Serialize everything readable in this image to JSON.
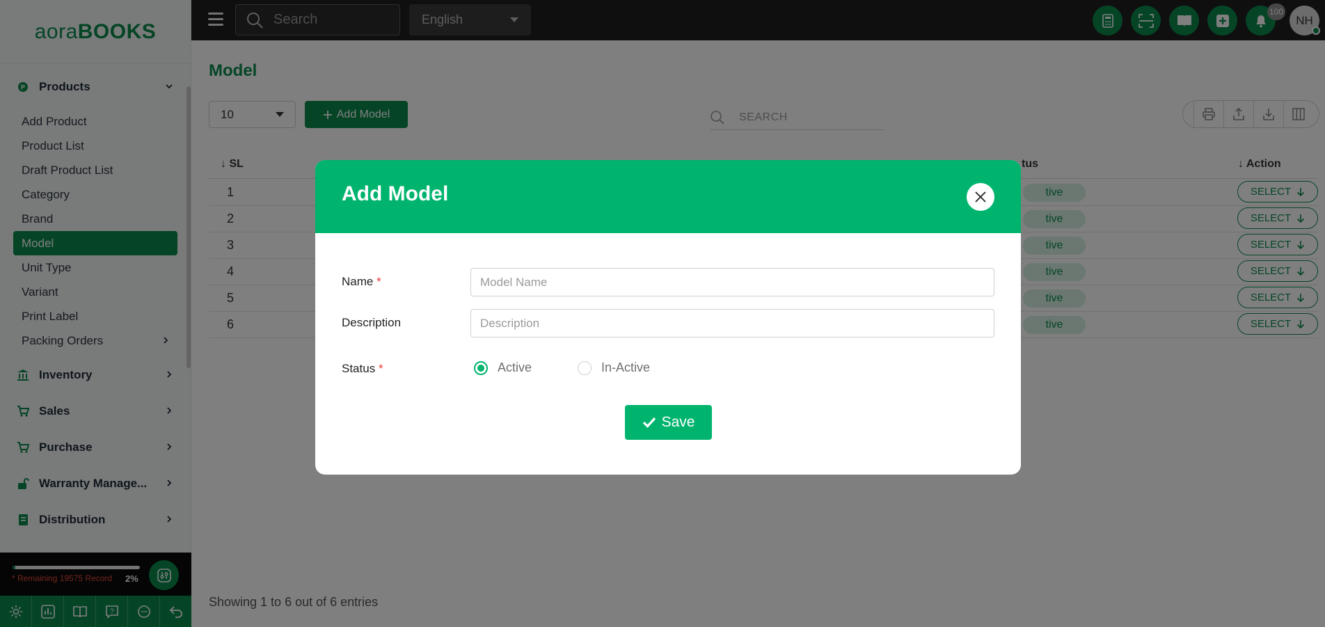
{
  "brand": {
    "logo_light": "aora",
    "logo_bold": "BOOKS"
  },
  "sidebar": {
    "groups": [
      {
        "label": "Products",
        "icon": "products-icon"
      },
      {
        "label": "Inventory",
        "icon": "bank-icon"
      },
      {
        "label": "Sales",
        "icon": "cart-icon"
      },
      {
        "label": "Purchase",
        "icon": "cart-icon"
      },
      {
        "label": "Warranty Manage...",
        "icon": "lock-icon"
      },
      {
        "label": "Distribution",
        "icon": "book-icon"
      }
    ],
    "items": [
      {
        "label": "Add Product"
      },
      {
        "label": "Product List"
      },
      {
        "label": "Draft Product List"
      },
      {
        "label": "Category"
      },
      {
        "label": "Brand"
      },
      {
        "label": "Model"
      },
      {
        "label": "Unit Type"
      },
      {
        "label": "Variant"
      },
      {
        "label": "Print Label"
      },
      {
        "label": "Packing Orders"
      }
    ],
    "remaining_text": "* Remaining 19575 Record",
    "remaining_pct": "2%",
    "remaining_fraction": 0.02
  },
  "topbar": {
    "search_placeholder": "Search",
    "language": "English",
    "notification_count": "100",
    "avatar_initials": "NH"
  },
  "page": {
    "title": "Model",
    "per_page": "10",
    "add_button_label": "Add Model",
    "search_placeholder": "SEARCH",
    "columns": {
      "sl": "SL",
      "status": "tus",
      "action": "Action"
    },
    "rows": [
      {
        "sl": "1",
        "status": "tive",
        "action": "SELECT"
      },
      {
        "sl": "2",
        "status": "tive",
        "action": "SELECT"
      },
      {
        "sl": "3",
        "status": "tive",
        "action": "SELECT"
      },
      {
        "sl": "4",
        "status": "tive",
        "action": "SELECT"
      },
      {
        "sl": "5",
        "status": "tive",
        "action": "SELECT"
      },
      {
        "sl": "6",
        "status": "tive",
        "action": "SELECT"
      }
    ],
    "footer": "Showing 1 to 6 out of 6 entries"
  },
  "modal": {
    "title": "Add Model",
    "name_label": "Name",
    "name_placeholder": "Model Name",
    "description_label": "Description",
    "description_placeholder": "Description",
    "status_label": "Status",
    "required_mark": "*",
    "status_options": [
      "Active",
      "In-Active"
    ],
    "status_selected": "Active",
    "save_label": "Save"
  },
  "colors": {
    "accent": "#0a8a4c",
    "modal_header": "#00b46e",
    "required": "#e53935"
  }
}
